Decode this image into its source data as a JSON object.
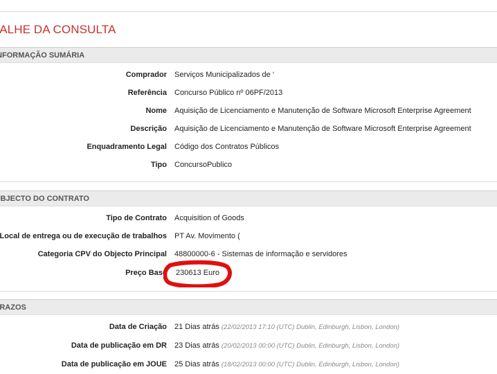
{
  "page_title": "TALHE DA CONSULTA",
  "sections": {
    "summary": {
      "title": "INFORMAÇÃO SUMÁRIA",
      "rows": [
        {
          "label": "Comprador",
          "value": "Serviços Municipalizados de ‘"
        },
        {
          "label": "Referência",
          "value": "Concurso Público nº 06PF/2013"
        },
        {
          "label": "Nome",
          "value": "Aquisição de Licenciamento e Manutenção de Software Microsoft Enterprise Agreement"
        },
        {
          "label": "Descrição",
          "value": "Aquisição de Licenciamento e Manutenção de Software Microsoft Enterprise Agreement"
        },
        {
          "label": "Enquadramento Legal",
          "value": "Código dos Contratos Públicos"
        },
        {
          "label": "Tipo",
          "value": "ConcursoPublico"
        }
      ]
    },
    "contract": {
      "title": "OBJECTO DO CONTRATO",
      "rows": [
        {
          "label": "Tipo de Contrato",
          "value": "Acquisition of Goods"
        },
        {
          "label": "Local de entrega ou de execução de trabalhos",
          "value": "PT Av. Movimento ("
        },
        {
          "label": "Categoria CPV do Objecto Principal",
          "value": "48800000-6 - Sistemas de informação e servidores"
        },
        {
          "label": "Preço Base",
          "value": "230613 Euro"
        }
      ]
    },
    "deadlines": {
      "title": "PRAZOS",
      "rows": [
        {
          "label": "Data de Criação",
          "value": "21 Dias atrás",
          "meta": "(22/02/2013 17:10 (UTC) Dublin, Edinburgh, Lisbon, London)"
        },
        {
          "label": "Data de publicação em DR",
          "value": "23 Dias atrás",
          "meta": "(20/02/2013 00:00 (UTC) Dublin, Edinburgh, Lisbon, London)"
        },
        {
          "label": "Data de publicação em JOUE",
          "value": "25 Dias atrás",
          "meta": "(18/02/2013 00:00 (UTC) Dublin, Edinburgh, Lisbon, London)"
        }
      ]
    }
  },
  "colors": {
    "title": "#c8312a",
    "annotation": "#e01010",
    "header_bg": "#ebebeb"
  }
}
